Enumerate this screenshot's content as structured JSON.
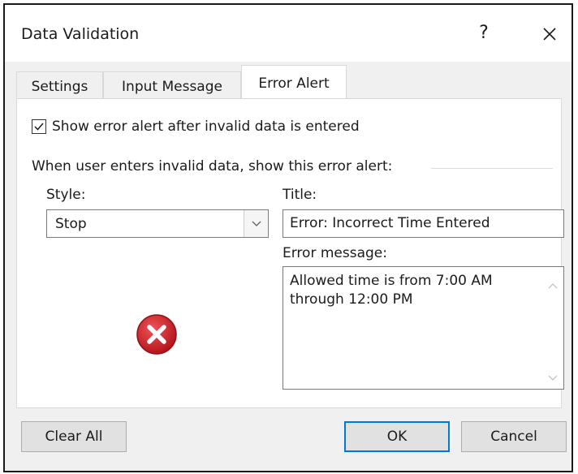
{
  "dialog": {
    "title": "Data Validation",
    "help_label": "?",
    "close_icon": "close-icon"
  },
  "tabs": [
    {
      "label": "Settings",
      "active": false
    },
    {
      "label": "Input Message",
      "active": false
    },
    {
      "label": "Error Alert",
      "active": true
    }
  ],
  "error_alert": {
    "show_alert_checked": true,
    "show_alert_label": "Show error alert after invalid data is entered",
    "group_label": "When user enters invalid data, show this error alert:",
    "style_label": "Style:",
    "style_value": "Stop",
    "title_label": "Title:",
    "title_value": "Error: Incorrect Time Entered",
    "message_label": "Error message:",
    "message_value": "Allowed time is from 7:00 AM through 12:00 PM",
    "style_icon": "stop-error-icon"
  },
  "buttons": {
    "clear_all": "Clear All",
    "ok": "OK",
    "cancel": "Cancel"
  },
  "colors": {
    "stop_icon_red": "#d2262b",
    "default_button_border": "#0078d7",
    "dialog_bg": "#f0f0f0"
  }
}
